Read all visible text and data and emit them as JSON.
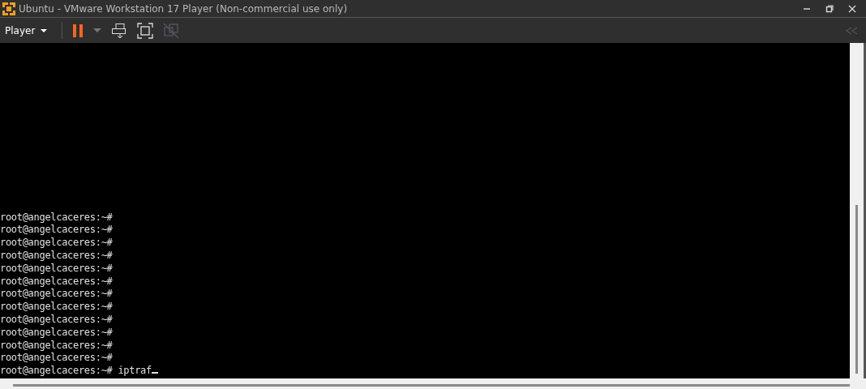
{
  "window": {
    "title": "Ubuntu - VMware Workstation 17 Player (Non-commercial use only)"
  },
  "toolbar": {
    "menu_label": "Player"
  },
  "terminal": {
    "lines": [
      {
        "prompt": "root@angelcaceres:~#"
      },
      {
        "prompt": "root@angelcaceres:~#"
      },
      {
        "prompt": "root@angelcaceres:~#"
      },
      {
        "prompt": "root@angelcaceres:~#"
      },
      {
        "prompt": "root@angelcaceres:~#"
      },
      {
        "prompt": "root@angelcaceres:~#"
      },
      {
        "prompt": "root@angelcaceres:~#"
      },
      {
        "prompt": "root@angelcaceres:~#"
      },
      {
        "prompt": "root@angelcaceres:~#"
      },
      {
        "prompt": "root@angelcaceres:~#"
      },
      {
        "prompt": "root@angelcaceres:~#"
      },
      {
        "prompt": "root@angelcaceres:~#"
      },
      {
        "prompt": "root@angelcaceres:~#",
        "command": "iptraf"
      }
    ]
  }
}
